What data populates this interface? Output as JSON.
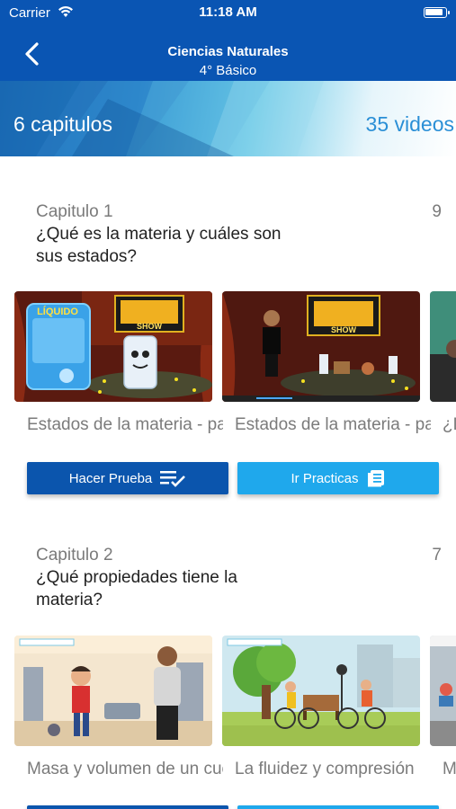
{
  "status_bar": {
    "carrier": "Carrier",
    "time": "11:18 AM"
  },
  "nav": {
    "title": "Ciencias Naturales",
    "subtitle": "4° Básico"
  },
  "banner": {
    "chapters": "6 capitulos",
    "videos": "35 videos"
  },
  "chapters": [
    {
      "label": "Capitulo 1",
      "count": "9",
      "title": "¿Qué es la materia y cuáles son sus estados?",
      "videos": [
        {
          "caption": "Estados de la materia - pa",
          "thumb_overlay": "LÍQUIDO",
          "show_title": "SHOW"
        },
        {
          "caption": "Estados de la materia - pa",
          "show_title": "SHOW"
        },
        {
          "caption": "¿De"
        }
      ],
      "buttons": {
        "test": "Hacer Prueba",
        "practice": "Ir Practicas"
      }
    },
    {
      "label": "Capitulo 2",
      "count": "7",
      "title": "¿Qué propiedades tiene la materia?",
      "videos": [
        {
          "caption": "Masa y volumen de un cue"
        },
        {
          "caption": "La fluidez y compresión"
        },
        {
          "caption": "M"
        }
      ]
    }
  ],
  "colors": {
    "primary": "#0a55b3",
    "accent": "#1fa8ec",
    "muted_text": "#7a7a7a"
  }
}
